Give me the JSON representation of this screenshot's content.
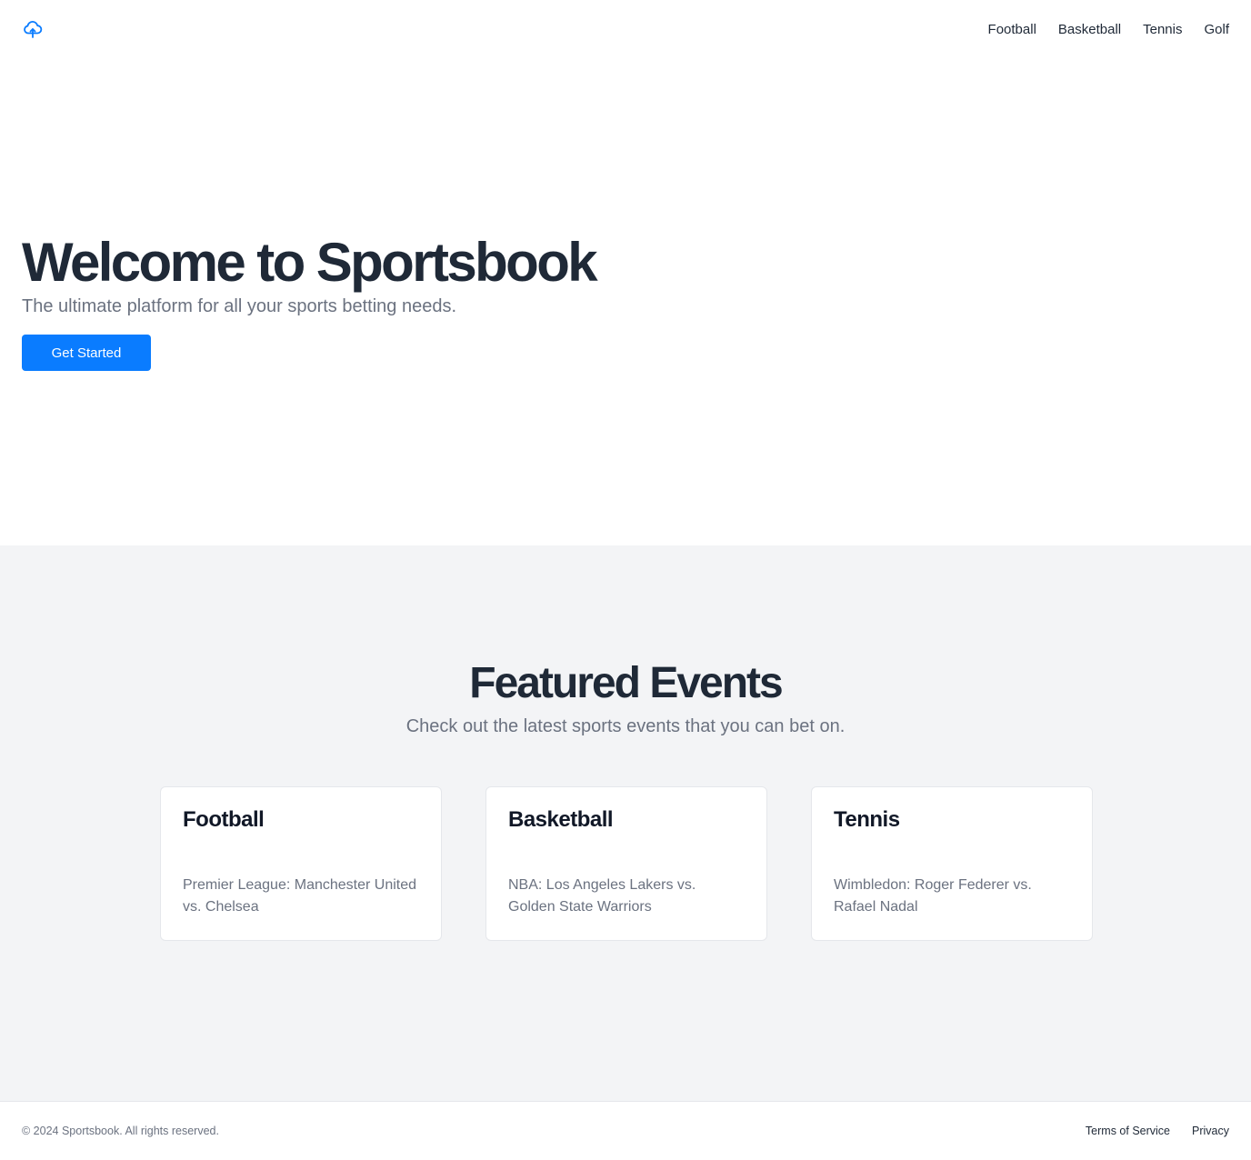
{
  "header": {
    "logo_icon": "cloud-icon",
    "brand_color": "#0a7cff",
    "nav": [
      {
        "label": "Football"
      },
      {
        "label": "Basketball"
      },
      {
        "label": "Tennis"
      },
      {
        "label": "Golf"
      }
    ]
  },
  "hero": {
    "title": "Welcome to Sportsbook",
    "subtitle": "The ultimate platform for all your sports betting needs.",
    "cta_label": "Get Started"
  },
  "featured": {
    "title": "Featured Events",
    "subtitle": "Check out the latest sports events that you can bet on.",
    "cards": [
      {
        "title": "Football",
        "description": "Premier League: Manchester United vs. Chelsea"
      },
      {
        "title": "Basketball",
        "description": "NBA: Los Angeles Lakers vs. Golden State Warriors"
      },
      {
        "title": "Tennis",
        "description": "Wimbledon: Roger Federer vs. Rafael Nadal"
      }
    ]
  },
  "footer": {
    "copyright": "© 2024 Sportsbook. All rights reserved.",
    "links": [
      {
        "label": "Terms of Service"
      },
      {
        "label": "Privacy"
      }
    ]
  }
}
